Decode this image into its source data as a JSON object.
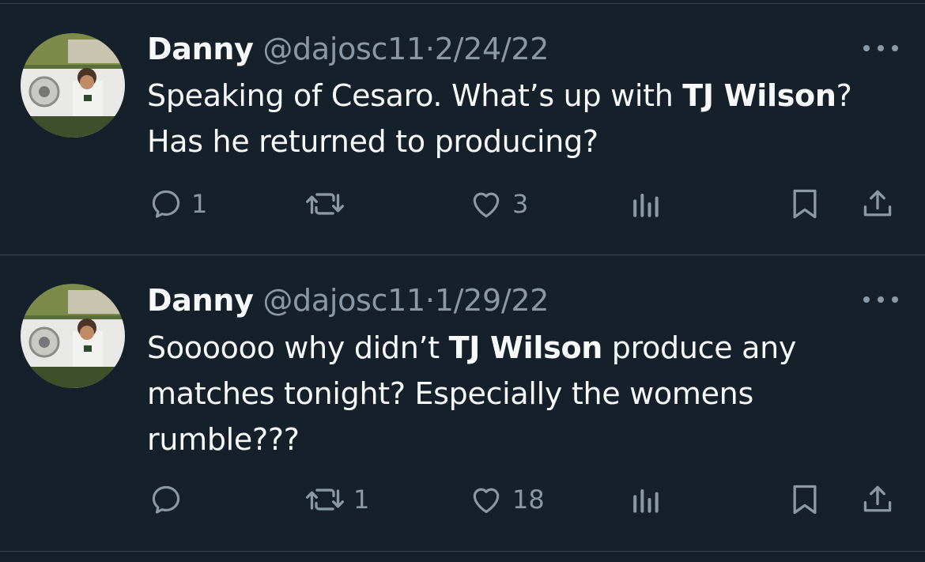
{
  "tweets": [
    {
      "name": "Danny",
      "handle": "@dajosc11",
      "separator": "·",
      "date": "2/24/22",
      "text_parts": [
        "Speaking of Cesaro. What’s up with ",
        "TJ Wilson",
        "?",
        "Has he returned to producing?"
      ],
      "replies": "1",
      "retweets": "",
      "likes": "3"
    },
    {
      "name": "Danny",
      "handle": "@dajosc11",
      "separator": "·",
      "date": "1/29/22",
      "text_parts": [
        "Soooooo why didn’t ",
        "TJ Wilson",
        " produce any",
        "matches tonight? Especially the womens",
        "rumble???"
      ],
      "replies": "",
      "retweets": "1",
      "likes": "18"
    }
  ],
  "icons": [
    "more-icon",
    "reply-icon",
    "retweet-icon",
    "like-icon",
    "views-icon",
    "bookmark-icon",
    "share-icon"
  ],
  "colors": {
    "background": "#15202b",
    "text": "#f7f9f9",
    "secondary": "#8b98a5",
    "divider": "#38444d"
  }
}
